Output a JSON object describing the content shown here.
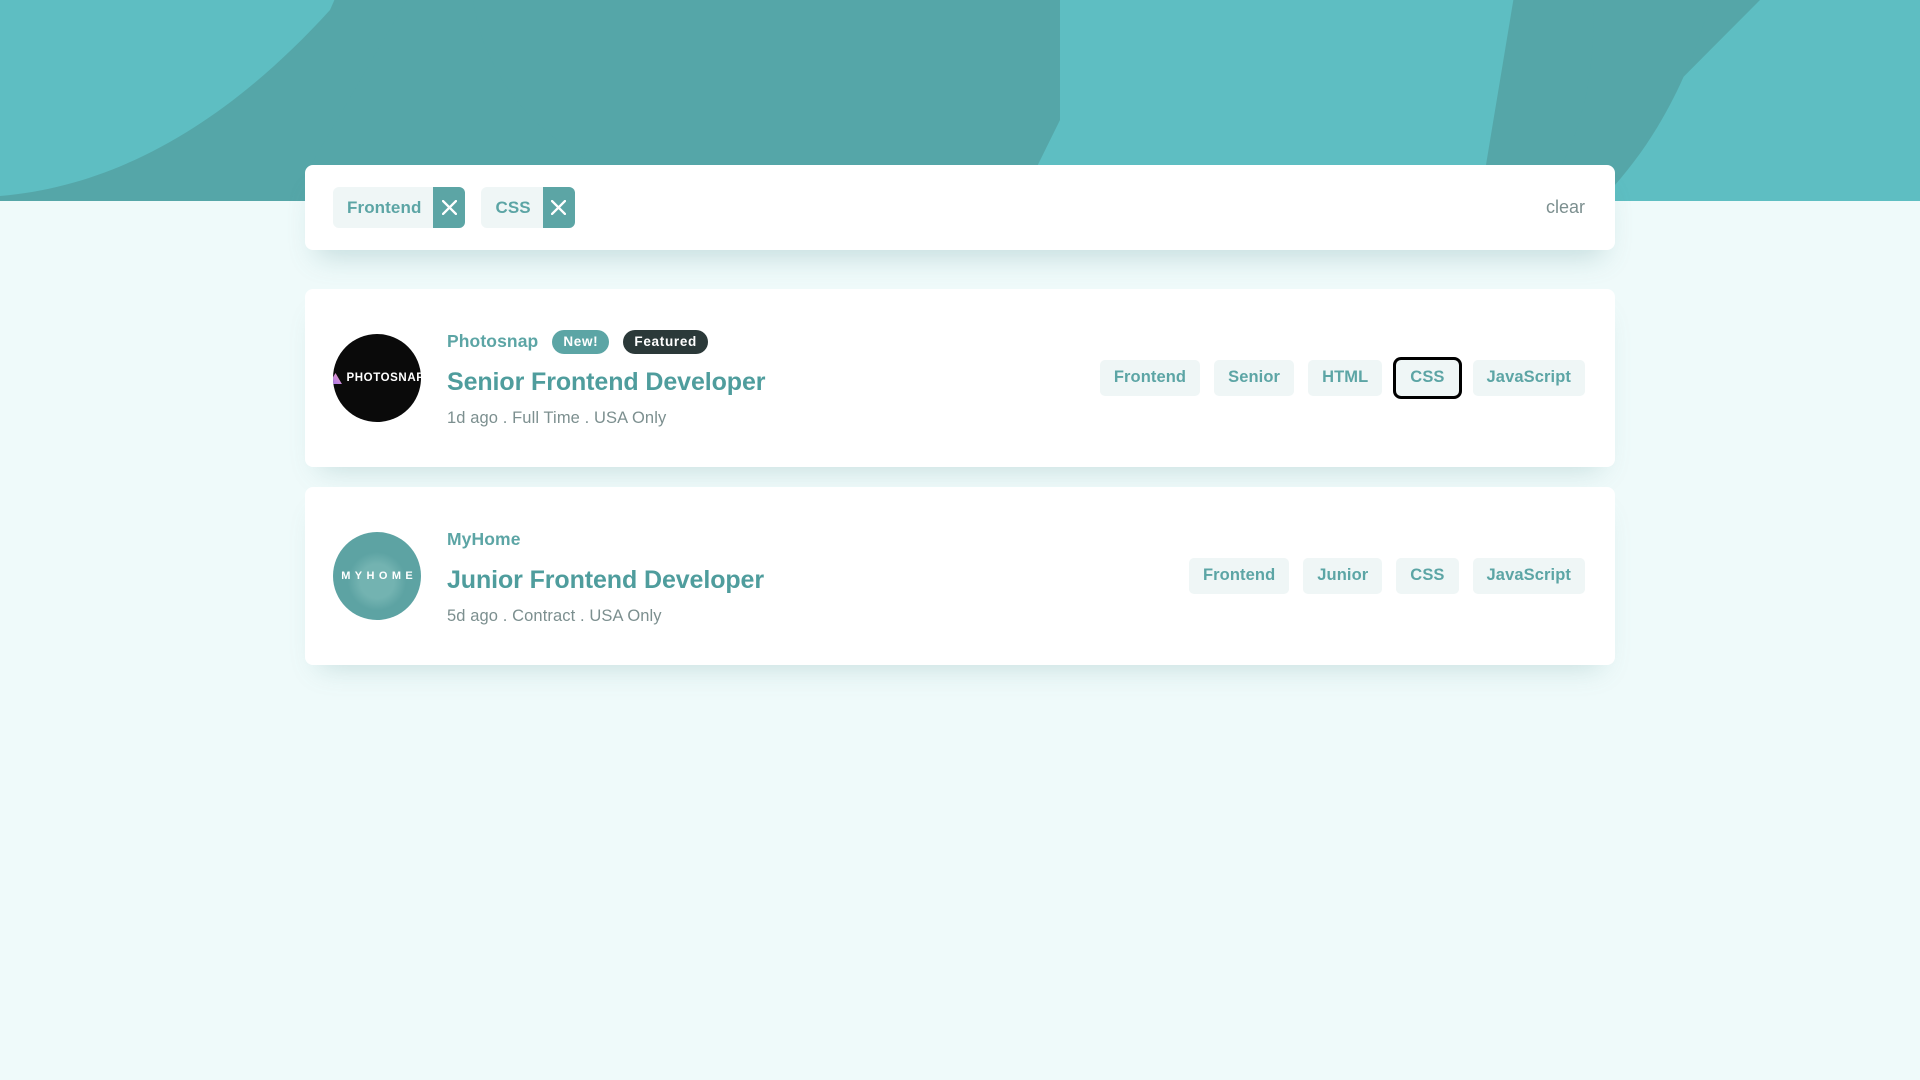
{
  "theme": {
    "banner_base": "#5ebec2",
    "banner_shape": "#55a6a8",
    "page_bg": "#effafa",
    "accent": "#5ca5a5",
    "accent_dark": "#2b3939",
    "tag_bg": "#eff6f6",
    "muted_text": "#7c8f8f",
    "card_bg": "#ffffff"
  },
  "filter_bar": {
    "name": "job-filter-bar",
    "pills": [
      {
        "label": "Frontend",
        "remove_icon": "close-icon"
      },
      {
        "label": "CSS",
        "remove_icon": "close-icon"
      }
    ],
    "clear_label": "clear"
  },
  "jobs": [
    {
      "company": "Photosnap",
      "logo": {
        "type": "photosnap",
        "text": "PHOTOSNAP",
        "icon": "triangle-icon"
      },
      "badges": [
        {
          "label": "New!",
          "style": "new"
        },
        {
          "label": "Featured",
          "style": "featured"
        }
      ],
      "title": "Senior Frontend Developer",
      "posted_at": "1d ago",
      "contract": "Full Time",
      "location": "USA Only",
      "meta": "1d ago . Full Time . USA Only",
      "tags": [
        {
          "label": "Frontend",
          "focused": false
        },
        {
          "label": "Senior",
          "focused": false
        },
        {
          "label": "HTML",
          "focused": false
        },
        {
          "label": "CSS",
          "focused": true
        },
        {
          "label": "JavaScript",
          "focused": false
        }
      ]
    },
    {
      "company": "MyHome",
      "logo": {
        "type": "myhome",
        "text": "MYHOME"
      },
      "badges": [],
      "title": "Junior Frontend Developer",
      "posted_at": "5d ago",
      "contract": "Contract",
      "location": "USA Only",
      "meta": "5d ago . Contract . USA Only",
      "tags": [
        {
          "label": "Frontend",
          "focused": false
        },
        {
          "label": "Junior",
          "focused": false
        },
        {
          "label": "CSS",
          "focused": false
        },
        {
          "label": "JavaScript",
          "focused": false
        }
      ]
    }
  ]
}
